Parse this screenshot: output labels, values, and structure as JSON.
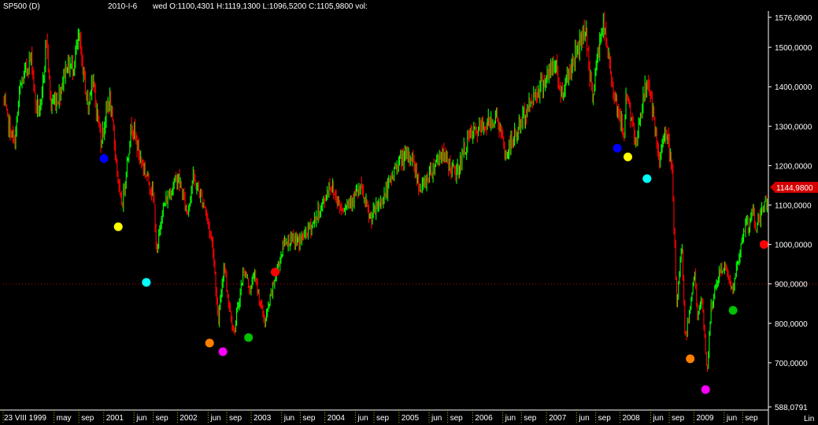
{
  "header": {
    "symbol": "SP500 (D)",
    "date": "2010-I-6",
    "ohlc": "wed O:1100,4301 H:1119,1300 L:1096,5200 C:1105,9800 vol:"
  },
  "colors": {
    "background": "#000000",
    "up_bar": "#00ff00",
    "down_bar": "#ff0000",
    "axis_line": "#ffffff",
    "last_price_bg": "#d40000",
    "ref_line": "#c00000"
  },
  "chart_data": {
    "type": "ohlc",
    "title": "SP500 (D)",
    "scale": "Lin",
    "y_range": [
      588.0791,
      1576.0901
    ],
    "y_ticks": [
      {
        "value": 1576.0901,
        "label": "1576,0900"
      },
      {
        "value": 1500,
        "label": "1500,0000"
      },
      {
        "value": 1400,
        "label": "1400,0000"
      },
      {
        "value": 1300,
        "label": "1300,0000"
      },
      {
        "value": 1200,
        "label": "1200,0000"
      },
      {
        "value": 1100,
        "label": "1100,0000"
      },
      {
        "value": 1000,
        "label": "1000,0000"
      },
      {
        "value": 900,
        "label": "900,0000"
      },
      {
        "value": 800,
        "label": "800,0000"
      },
      {
        "value": 700,
        "label": "700,0000"
      },
      {
        "value": 588.0791,
        "label": "588,0791"
      }
    ],
    "last_price": {
      "value": 1144.98,
      "label": "1144,9800"
    },
    "reference_level": 900,
    "x_range": [
      "1999-08-23",
      "2010-01-06"
    ],
    "x_ticks": [
      {
        "date": "1999-08-23",
        "label": "23 VIII 1999"
      },
      {
        "date": "2000-05-01",
        "label": "may"
      },
      {
        "date": "2000-09-01",
        "label": "sep"
      },
      {
        "date": "2001-01-02",
        "label": "2001"
      },
      {
        "date": "2001-06-01",
        "label": "jun"
      },
      {
        "date": "2001-09-04",
        "label": "sep"
      },
      {
        "date": "2002-01-02",
        "label": "2002"
      },
      {
        "date": "2002-06-03",
        "label": "jun"
      },
      {
        "date": "2002-09-03",
        "label": "sep"
      },
      {
        "date": "2003-01-02",
        "label": "2003"
      },
      {
        "date": "2003-06-02",
        "label": "jun"
      },
      {
        "date": "2003-09-02",
        "label": "sep"
      },
      {
        "date": "2004-01-02",
        "label": "2004"
      },
      {
        "date": "2004-06-01",
        "label": "jun"
      },
      {
        "date": "2004-09-01",
        "label": "sep"
      },
      {
        "date": "2005-01-03",
        "label": "2005"
      },
      {
        "date": "2005-06-01",
        "label": "jun"
      },
      {
        "date": "2005-09-01",
        "label": "sep"
      },
      {
        "date": "2006-01-03",
        "label": "2006"
      },
      {
        "date": "2006-06-01",
        "label": "jun"
      },
      {
        "date": "2006-09-01",
        "label": "sep"
      },
      {
        "date": "2007-01-03",
        "label": "2007"
      },
      {
        "date": "2007-06-01",
        "label": "jun"
      },
      {
        "date": "2007-09-04",
        "label": "sep"
      },
      {
        "date": "2008-01-02",
        "label": "2008"
      },
      {
        "date": "2008-06-02",
        "label": "jun"
      },
      {
        "date": "2008-09-02",
        "label": "sep"
      },
      {
        "date": "2009-01-02",
        "label": "2009"
      },
      {
        "date": "2009-06-01",
        "label": "jun"
      },
      {
        "date": "2009-09-01",
        "label": "sep"
      }
    ],
    "series": [
      {
        "values": [
          [
            "1999-08-23",
            1370
          ],
          [
            "1999-09-15",
            1310
          ],
          [
            "1999-10-18",
            1255
          ],
          [
            "1999-11-15",
            1395
          ],
          [
            "1999-12-31",
            1469
          ],
          [
            "2000-01-14",
            1465
          ],
          [
            "2000-01-28",
            1360
          ],
          [
            "2000-02-25",
            1333
          ],
          [
            "2000-03-24",
            1527
          ],
          [
            "2000-04-14",
            1356
          ],
          [
            "2000-05-24",
            1374
          ],
          [
            "2000-06-30",
            1455
          ],
          [
            "2000-08-01",
            1450
          ],
          [
            "2000-09-01",
            1520
          ],
          [
            "2000-10-18",
            1342
          ],
          [
            "2000-11-03",
            1428
          ],
          [
            "2000-12-20",
            1264
          ],
          [
            "2001-01-30",
            1373
          ],
          [
            "2001-02-28",
            1240
          ],
          [
            "2001-03-22",
            1117
          ],
          [
            "2001-04-04",
            1103
          ],
          [
            "2001-05-21",
            1312
          ],
          [
            "2001-06-29",
            1224
          ],
          [
            "2001-08-31",
            1134
          ],
          [
            "2001-09-10",
            1092
          ],
          [
            "2001-09-21",
            965
          ],
          [
            "2001-10-15",
            1080
          ],
          [
            "2001-11-30",
            1139
          ],
          [
            "2002-01-04",
            1172
          ],
          [
            "2002-02-21",
            1080
          ],
          [
            "2002-03-19",
            1170
          ],
          [
            "2002-05-16",
            1100
          ],
          [
            "2002-06-28",
            990
          ],
          [
            "2002-07-23",
            797
          ],
          [
            "2002-08-22",
            962
          ],
          [
            "2002-09-04",
            880
          ],
          [
            "2002-10-09",
            776
          ],
          [
            "2002-11-27",
            938
          ],
          [
            "2002-12-31",
            880
          ],
          [
            "2003-01-14",
            930
          ],
          [
            "2003-03-11",
            800
          ],
          [
            "2003-04-30",
            916
          ],
          [
            "2003-06-17",
            1011
          ],
          [
            "2003-08-29",
            1008
          ],
          [
            "2003-10-31",
            1050
          ],
          [
            "2003-12-31",
            1111
          ],
          [
            "2004-01-26",
            1155
          ],
          [
            "2004-03-24",
            1091
          ],
          [
            "2004-06-30",
            1140
          ],
          [
            "2004-08-12",
            1063
          ],
          [
            "2004-10-29",
            1130
          ],
          [
            "2004-12-31",
            1212
          ],
          [
            "2005-03-07",
            1225
          ],
          [
            "2005-04-20",
            1137
          ],
          [
            "2005-07-29",
            1234
          ],
          [
            "2005-10-13",
            1177
          ],
          [
            "2005-12-14",
            1272
          ],
          [
            "2006-05-05",
            1325
          ],
          [
            "2006-06-13",
            1223
          ],
          [
            "2006-10-31",
            1377
          ],
          [
            "2007-02-20",
            1459
          ],
          [
            "2007-03-13",
            1377
          ],
          [
            "2007-07-16",
            1555
          ],
          [
            "2007-08-16",
            1370
          ],
          [
            "2007-10-09",
            1565
          ],
          [
            "2007-11-26",
            1407
          ],
          [
            "2008-01-22",
            1270
          ],
          [
            "2008-02-01",
            1396
          ],
          [
            "2008-03-17",
            1257
          ],
          [
            "2008-05-19",
            1426
          ],
          [
            "2008-07-15",
            1200
          ],
          [
            "2008-08-11",
            1305
          ],
          [
            "2008-09-15",
            1192
          ],
          [
            "2008-10-10",
            839
          ],
          [
            "2008-11-04",
            1005
          ],
          [
            "2008-11-20",
            752
          ],
          [
            "2009-01-06",
            934
          ],
          [
            "2009-01-20",
            805
          ],
          [
            "2009-02-09",
            869
          ],
          [
            "2009-03-09",
            676
          ],
          [
            "2009-03-26",
            832
          ],
          [
            "2009-05-08",
            929
          ],
          [
            "2009-06-12",
            946
          ],
          [
            "2009-07-10",
            879
          ],
          [
            "2009-09-23",
            1071
          ],
          [
            "2009-10-02",
            1025
          ],
          [
            "2009-10-21",
            1097
          ],
          [
            "2009-11-02",
            1042
          ],
          [
            "2009-12-31",
            1115
          ],
          [
            "2010-01-06",
            1144.98
          ]
        ]
      }
    ],
    "markers": [
      {
        "date": "2001-01-03",
        "value": 1218,
        "color": "#0000ff"
      },
      {
        "date": "2001-03-15",
        "value": 1045,
        "color": "#ffff00"
      },
      {
        "date": "2001-08-01",
        "value": 904,
        "color": "#00ffff"
      },
      {
        "date": "2002-06-10",
        "value": 750,
        "color": "#ff8000"
      },
      {
        "date": "2002-08-15",
        "value": 728,
        "color": "#ff00ff"
      },
      {
        "date": "2002-12-20",
        "value": 764,
        "color": "#00c000"
      },
      {
        "date": "2003-05-01",
        "value": 930,
        "color": "#ff0000"
      },
      {
        "date": "2007-12-20",
        "value": 1244,
        "color": "#0000ff"
      },
      {
        "date": "2008-02-10",
        "value": 1222,
        "color": "#ffff00"
      },
      {
        "date": "2008-05-15",
        "value": 1167,
        "color": "#00ffff"
      },
      {
        "date": "2008-12-15",
        "value": 710,
        "color": "#ff8000"
      },
      {
        "date": "2009-03-01",
        "value": 632,
        "color": "#ff00ff"
      },
      {
        "date": "2009-07-15",
        "value": 833,
        "color": "#00c000"
      },
      {
        "date": "2009-12-15",
        "value": 1000,
        "color": "#ff0000"
      }
    ]
  }
}
